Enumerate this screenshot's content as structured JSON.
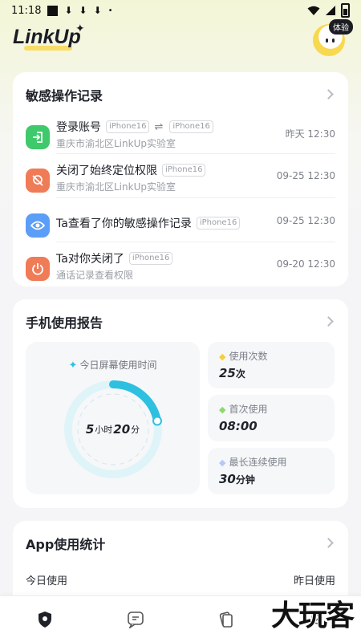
{
  "status_bar": {
    "time": "11:18",
    "download_glyph": "⬇",
    "dot": "•"
  },
  "header": {
    "logo": "LinkUp",
    "logo_sparkle": "✦",
    "badge": "体验"
  },
  "sensitive": {
    "title": "敏感操作记录",
    "items": [
      {
        "icon": "login-icon",
        "color": "#3ec96b",
        "title": "登录账号",
        "tag_a": "iPhone16",
        "swap": "⇌",
        "tag_b": "iPhone16",
        "sub": "重庆市渝北区LinkUp实验室",
        "time": "昨天 12:30"
      },
      {
        "icon": "location-off-icon",
        "color": "#f07b57",
        "title": "关闭了始终定位权限",
        "tag_a": "iPhone16",
        "sub": "重庆市渝北区LinkUp实验室",
        "time": "09-25 12:30"
      },
      {
        "icon": "eye-icon",
        "color": "#5b9ef7",
        "title": "Ta查看了你的敏感操作记录",
        "tag_a": "iPhone16",
        "sub": "",
        "time": "09-25 12:30"
      },
      {
        "icon": "power-icon",
        "color": "#f07b57",
        "title": "Ta对你关闭了",
        "tag_a": "iPhone16",
        "sub": "通话记录查看权限",
        "time": "09-20 12:30"
      }
    ]
  },
  "report": {
    "title": "手机使用报告",
    "screen_time_label": "今日屏幕使用时间",
    "screen_time_hours": "5",
    "screen_time_hours_unit": "小时",
    "screen_time_minutes": "20",
    "screen_time_minutes_unit": "分",
    "screen_time_progress": 0.22,
    "accent": "#2ec0e0",
    "stats": [
      {
        "label": "使用次数",
        "value": "25",
        "unit": "次",
        "diamond_color": "#f4cf3c"
      },
      {
        "label": "首次使用",
        "value": "08:00",
        "unit": "",
        "diamond_color": "#8fd86a"
      },
      {
        "label": "最长连续使用",
        "value": "30",
        "unit": "分钟",
        "diamond_color": "#b8c8f5"
      }
    ]
  },
  "app_stats": {
    "title": "App使用统计",
    "today_label": "今日使用",
    "yesterday_label": "昨日使用"
  },
  "watermark": "大玩客"
}
